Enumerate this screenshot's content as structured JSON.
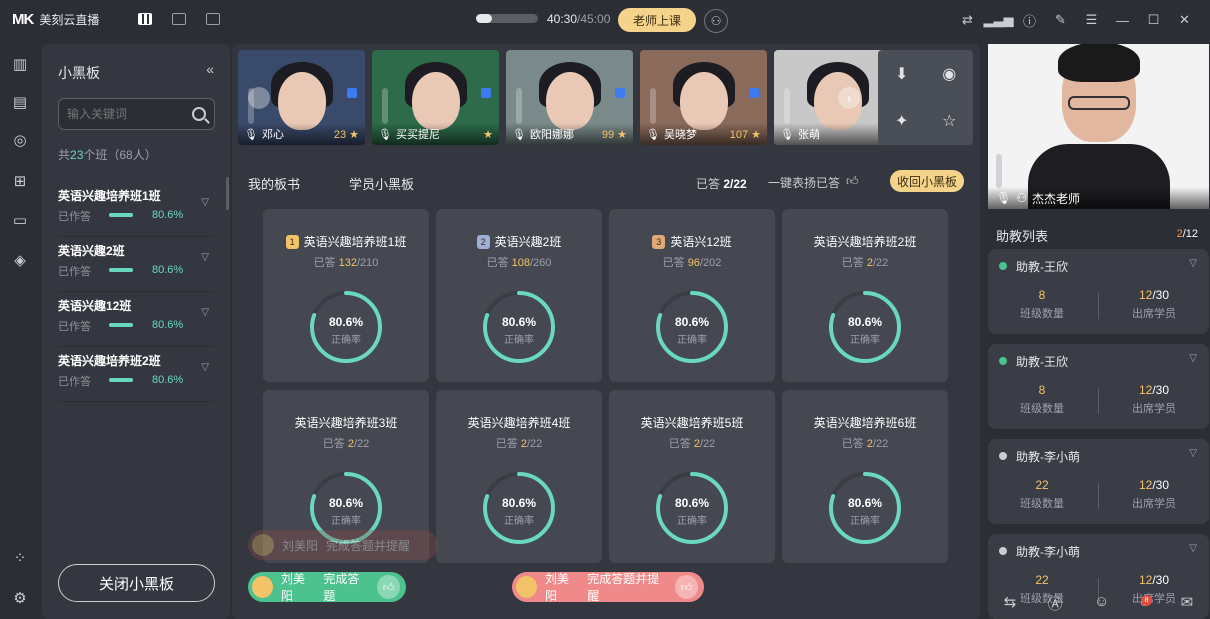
{
  "app": {
    "logo_mark": "MK",
    "title": "美刻云直播"
  },
  "topbar": {
    "progress_fraction": 0.25,
    "time_elapsed": "40:30",
    "time_total": "/45:00",
    "start_label": "老师上课",
    "icons": [
      "layout-grid-icon",
      "layout-single-icon",
      "layout-multi-icon",
      "swap-icon",
      "signal-icon",
      "info-icon",
      "tools-icon",
      "menu-icon",
      "minimize-icon",
      "maximize-icon",
      "close-icon"
    ]
  },
  "panel": {
    "title": "小黑板",
    "search_placeholder": "输入关键词",
    "count_prefix": "共",
    "count_num": "23",
    "count_suffix": "个班（68人）",
    "classes": [
      {
        "name": "英语兴趣培养班1班",
        "status": "已作答",
        "pct": "80.6%"
      },
      {
        "name": "英语兴趣2班",
        "status": "已作答",
        "pct": "80.6%"
      },
      {
        "name": "英语兴趣12班",
        "status": "已作答",
        "pct": "80.6%"
      },
      {
        "name": "英语兴趣培养班2班",
        "status": "已作答",
        "pct": "80.6%"
      }
    ],
    "close_label": "关闭小黑板"
  },
  "students": [
    {
      "name": "邓心",
      "score": "23",
      "color": "#3a4a6a"
    },
    {
      "name": "买买提尼",
      "score": "",
      "color": "#2d6b4a"
    },
    {
      "name": "欧阳娜娜",
      "score": "99",
      "color": "#7a8a8a"
    },
    {
      "name": "吴晓梦",
      "score": "107",
      "color": "#8a6a5a"
    },
    {
      "name": "张萌",
      "score": "",
      "color": "#c8c8c8"
    }
  ],
  "tabs": {
    "mine": "我的板书",
    "students": "学员小黑板"
  },
  "answered": {
    "prefix": "已答",
    "value": "2/22"
  },
  "praise_label": "一键表扬已答",
  "recall_label": "收回小黑板",
  "cards": [
    {
      "name": "英语兴趣培养班1班",
      "rank": "1",
      "rank_color": "#f3c36a",
      "ans": "132",
      "total": "/210",
      "pct": "80.6%",
      "fraction": 0.806,
      "label": "正确率"
    },
    {
      "name": "英语兴趣2班",
      "rank": "2",
      "rank_color": "#9fb0d8",
      "ans": "108",
      "total": "/260",
      "pct": "80.6%",
      "fraction": 0.806,
      "label": "正确率"
    },
    {
      "name": "英语兴12班",
      "rank": "3",
      "rank_color": "#e0a97a",
      "ans": "96",
      "total": "/202",
      "pct": "80.6%",
      "fraction": 0.806,
      "label": "正确率"
    },
    {
      "name": "英语兴趣培养班2班",
      "rank": "",
      "rank_color": "",
      "ans": "2",
      "total": "/22",
      "pct": "80.6%",
      "fraction": 0.806,
      "label": "正确率"
    },
    {
      "name": "英语兴趣培养班3班",
      "rank": "",
      "rank_color": "",
      "ans": "2",
      "total": "/22",
      "pct": "80.6%",
      "fraction": 0.806,
      "label": "正确率"
    },
    {
      "name": "英语兴趣培养班4班",
      "rank": "",
      "rank_color": "",
      "ans": "2",
      "total": "/22",
      "pct": "80.6%",
      "fraction": 0.806,
      "label": "正确率"
    },
    {
      "name": "英语兴趣培养班5班",
      "rank": "",
      "rank_color": "",
      "ans": "2",
      "total": "/22",
      "pct": "80.6%",
      "fraction": 0.806,
      "label": "正确率"
    },
    {
      "name": "英语兴趣培养班6班",
      "rank": "",
      "rank_color": "",
      "ans": "2",
      "total": "/22",
      "pct": "80.6%",
      "fraction": 0.806,
      "label": "正确率"
    }
  ],
  "answered_prefix": "已答",
  "toasts": [
    {
      "name": "刘美阳",
      "msg": "完成答题",
      "color": "#4cc28f"
    },
    {
      "name": "刘美阳",
      "msg": "完成答题并提醒",
      "color": "#f08a8a"
    }
  ],
  "teacher": {
    "name": "杰杰老师"
  },
  "assistants": {
    "title": "助教列表",
    "count_cur": "2",
    "count_total": "/12",
    "items": [
      {
        "name": "助教-王欣",
        "online": true,
        "classes": "8",
        "attend": "12",
        "attend_total": "/30",
        "classes_label": "班级数量",
        "attend_label": "出席学员"
      },
      {
        "name": "助教-王欣",
        "online": true,
        "classes": "8",
        "attend": "12",
        "attend_total": "/30",
        "classes_label": "班级数量",
        "attend_label": "出席学员"
      },
      {
        "name": "助教-李小萌",
        "online": false,
        "classes": "22",
        "attend": "12",
        "attend_total": "/30",
        "classes_label": "班级数量",
        "attend_label": "出席学员"
      },
      {
        "name": "助教-李小萌",
        "online": false,
        "classes": "22",
        "attend": "12",
        "attend_total": "/30",
        "classes_label": "班级数量",
        "attend_label": "出席学员"
      }
    ]
  },
  "hand_count": "8",
  "colors": {
    "accent": "#6ad7c1",
    "gold": "#f6d38b",
    "bg": "#2b2e35",
    "panel": "#34373f"
  }
}
